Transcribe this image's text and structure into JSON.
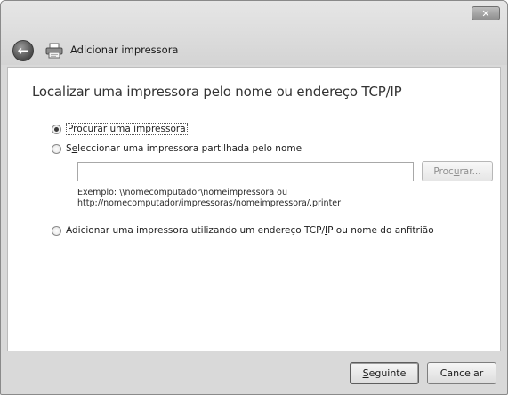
{
  "window": {
    "close_label": "✕"
  },
  "header": {
    "back_label": "←",
    "title": "Adicionar impressora"
  },
  "main": {
    "heading": "Localizar uma impressora pelo nome ou endereço TCP/IP",
    "options": [
      {
        "label_prefix": "",
        "label_accel": "P",
        "label_rest": "rocurar uma impressora",
        "checked": true
      },
      {
        "label_prefix": "S",
        "label_accel": "e",
        "label_rest": "leccionar uma impressora partilhada pelo nome",
        "checked": false
      },
      {
        "label_prefix": "Adicionar uma impressora utilizando um endereço TCP/",
        "label_accel": "I",
        "label_rest": "P ou nome do anfitrião",
        "checked": false
      }
    ],
    "printer_name": {
      "value": "",
      "placeholder": ""
    },
    "browse_label_prefix": "Proc",
    "browse_label_accel": "u",
    "browse_label_rest": "rar...",
    "example_line1": "Exemplo: \\\\nomecomputador\\nomeimpressora ou",
    "example_line2": "http://nomecomputador/impressoras/nomeimpressora/.printer"
  },
  "footer": {
    "next_accel": "S",
    "next_rest": "eguinte",
    "cancel_label": "Cancelar"
  },
  "colors": {
    "frame": "#d9d9d9",
    "content_bg": "#ffffff",
    "heading_text": "#333333",
    "disabled_text": "#8e8e8e"
  }
}
